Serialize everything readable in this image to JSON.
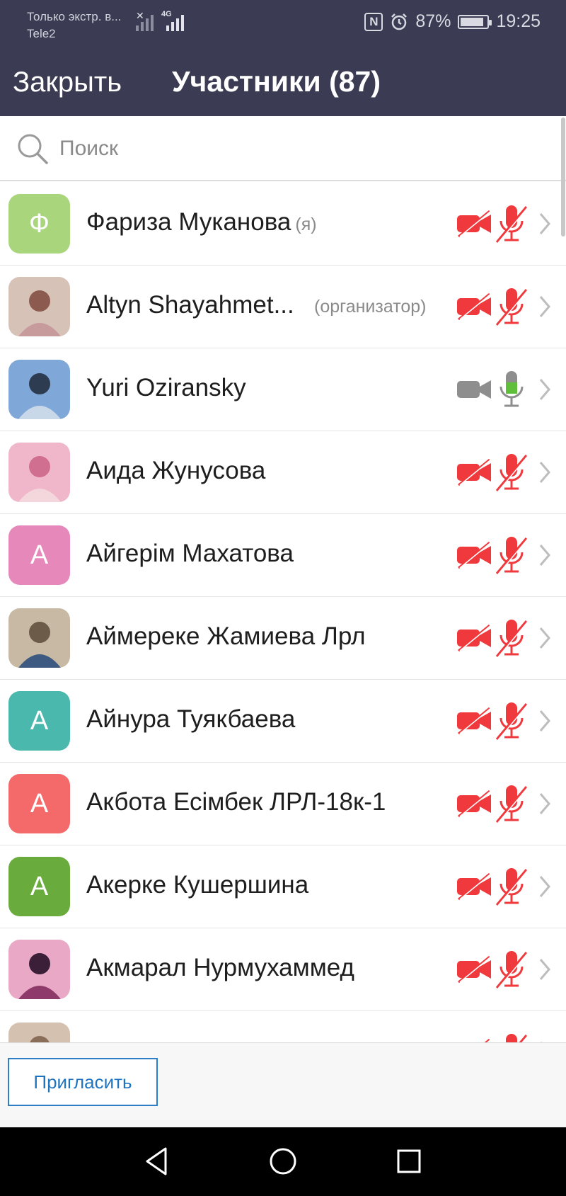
{
  "status_bar": {
    "carrier_line1": "Только экстр. в...",
    "carrier_line2": "Tele2",
    "network_type": "4G",
    "battery_percent": "87%",
    "battery_level": 0.87,
    "time": "19:25"
  },
  "header": {
    "close_label": "Закрыть",
    "title": "Участники (87)"
  },
  "search": {
    "placeholder": "Поиск",
    "value": ""
  },
  "colors": {
    "header_bg": "#3b3b53",
    "muted_red": "#f0393d",
    "active_green": "#5fbf3a",
    "link_blue": "#1f74c0"
  },
  "participants": [
    {
      "name": "Фариза Муканова",
      "role": "(я)",
      "avatar_type": "initial",
      "initial": "Ф",
      "avatar_color": "#a9d67c",
      "video": "off",
      "audio": "off"
    },
    {
      "name": "Altyn Shayahmet...",
      "role": "(организатор)",
      "avatar_type": "photo",
      "avatar_icon": "photo-avatar",
      "video": "off",
      "audio": "off"
    },
    {
      "name": "Yuri Oziransky",
      "role": "",
      "avatar_type": "photo",
      "avatar_icon": "photo-avatar",
      "video": "on-idle",
      "audio": "on"
    },
    {
      "name": "Аида Жунусова",
      "role": "",
      "avatar_type": "photo",
      "avatar_icon": "photo-avatar",
      "video": "off",
      "audio": "off"
    },
    {
      "name": "Айгерім Махатова",
      "role": "",
      "avatar_type": "initial",
      "initial": "А",
      "avatar_color": "#e788bb",
      "video": "off",
      "audio": "off"
    },
    {
      "name": "Аймереке Жамиева Лрл",
      "role": "",
      "avatar_type": "photo",
      "avatar_icon": "photo-avatar",
      "video": "off",
      "audio": "off"
    },
    {
      "name": "Айнура Туякбаева",
      "role": "",
      "avatar_type": "initial",
      "initial": "А",
      "avatar_color": "#4ab8ad",
      "video": "off",
      "audio": "off"
    },
    {
      "name": "Акбота Есімбек ЛРЛ-18к-1",
      "role": "",
      "avatar_type": "initial",
      "initial": "А",
      "avatar_color": "#f46a6a",
      "video": "off",
      "audio": "off"
    },
    {
      "name": "Акерке Кушершина",
      "role": "",
      "avatar_type": "initial",
      "initial": "А",
      "avatar_color": "#6aab3d",
      "video": "off",
      "audio": "off"
    },
    {
      "name": "Акмарал Нурмухаммед",
      "role": "",
      "avatar_type": "photo",
      "avatar_icon": "photo-avatar",
      "video": "off",
      "audio": "off"
    },
    {
      "name": "",
      "role": "",
      "avatar_type": "photo",
      "avatar_icon": "photo-avatar",
      "video": "off",
      "audio": "off"
    }
  ],
  "footer": {
    "invite_label": "Пригласить"
  },
  "nav_bar": {
    "back_icon": "triangle-back-icon",
    "home_icon": "circle-home-icon",
    "recents_icon": "square-recents-icon"
  }
}
